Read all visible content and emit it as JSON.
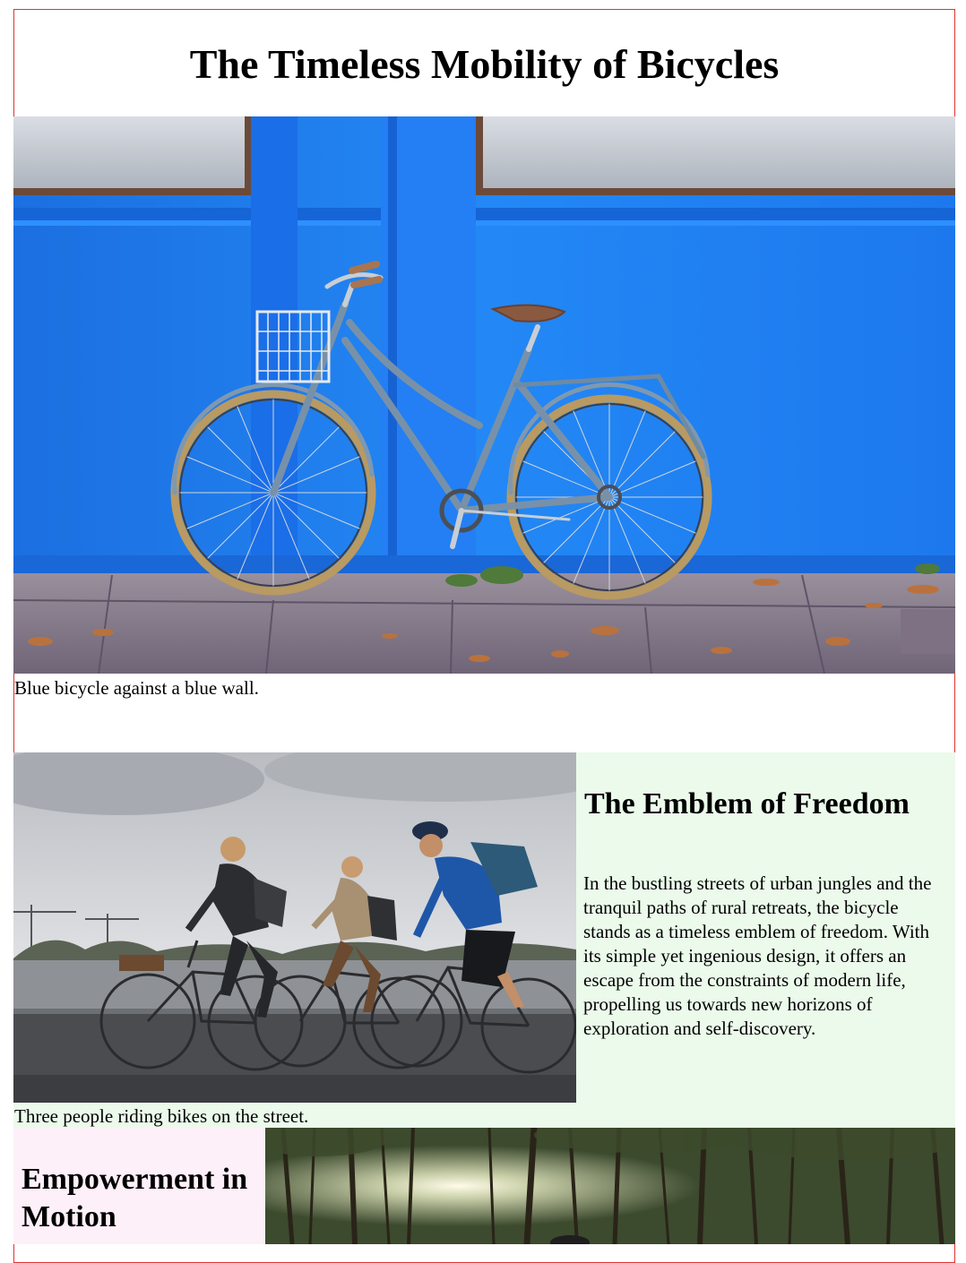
{
  "page": {
    "title": "The Timeless Mobility of Bicycles"
  },
  "hero": {
    "image_alt": "Blue bicycle against a blue wall.",
    "caption": "Blue bicycle against a blue wall."
  },
  "freedom": {
    "image_alt": "Three people riding bikes on the street.",
    "caption": "Three people riding bikes on the street.",
    "heading": "The Emblem of Freedom",
    "paragraph": "In the bustling streets of urban jungles and the tranquil paths of rural retreats, the bicycle stands as a timeless emblem of freedom. With its simple yet ingenious design, it offers an escape from the constraints of modern life, propelling us towards new horizons of exploration and self-discovery."
  },
  "empowerment": {
    "heading": "Empowerment in Motion",
    "image_alt": "Forest trail with sunlight"
  },
  "colors": {
    "frame_border": "#dd3333",
    "freedom_background": "#ebfaeb",
    "empowerment_background": "#fdf0f8",
    "wall_blue": "#1f7ff0"
  }
}
